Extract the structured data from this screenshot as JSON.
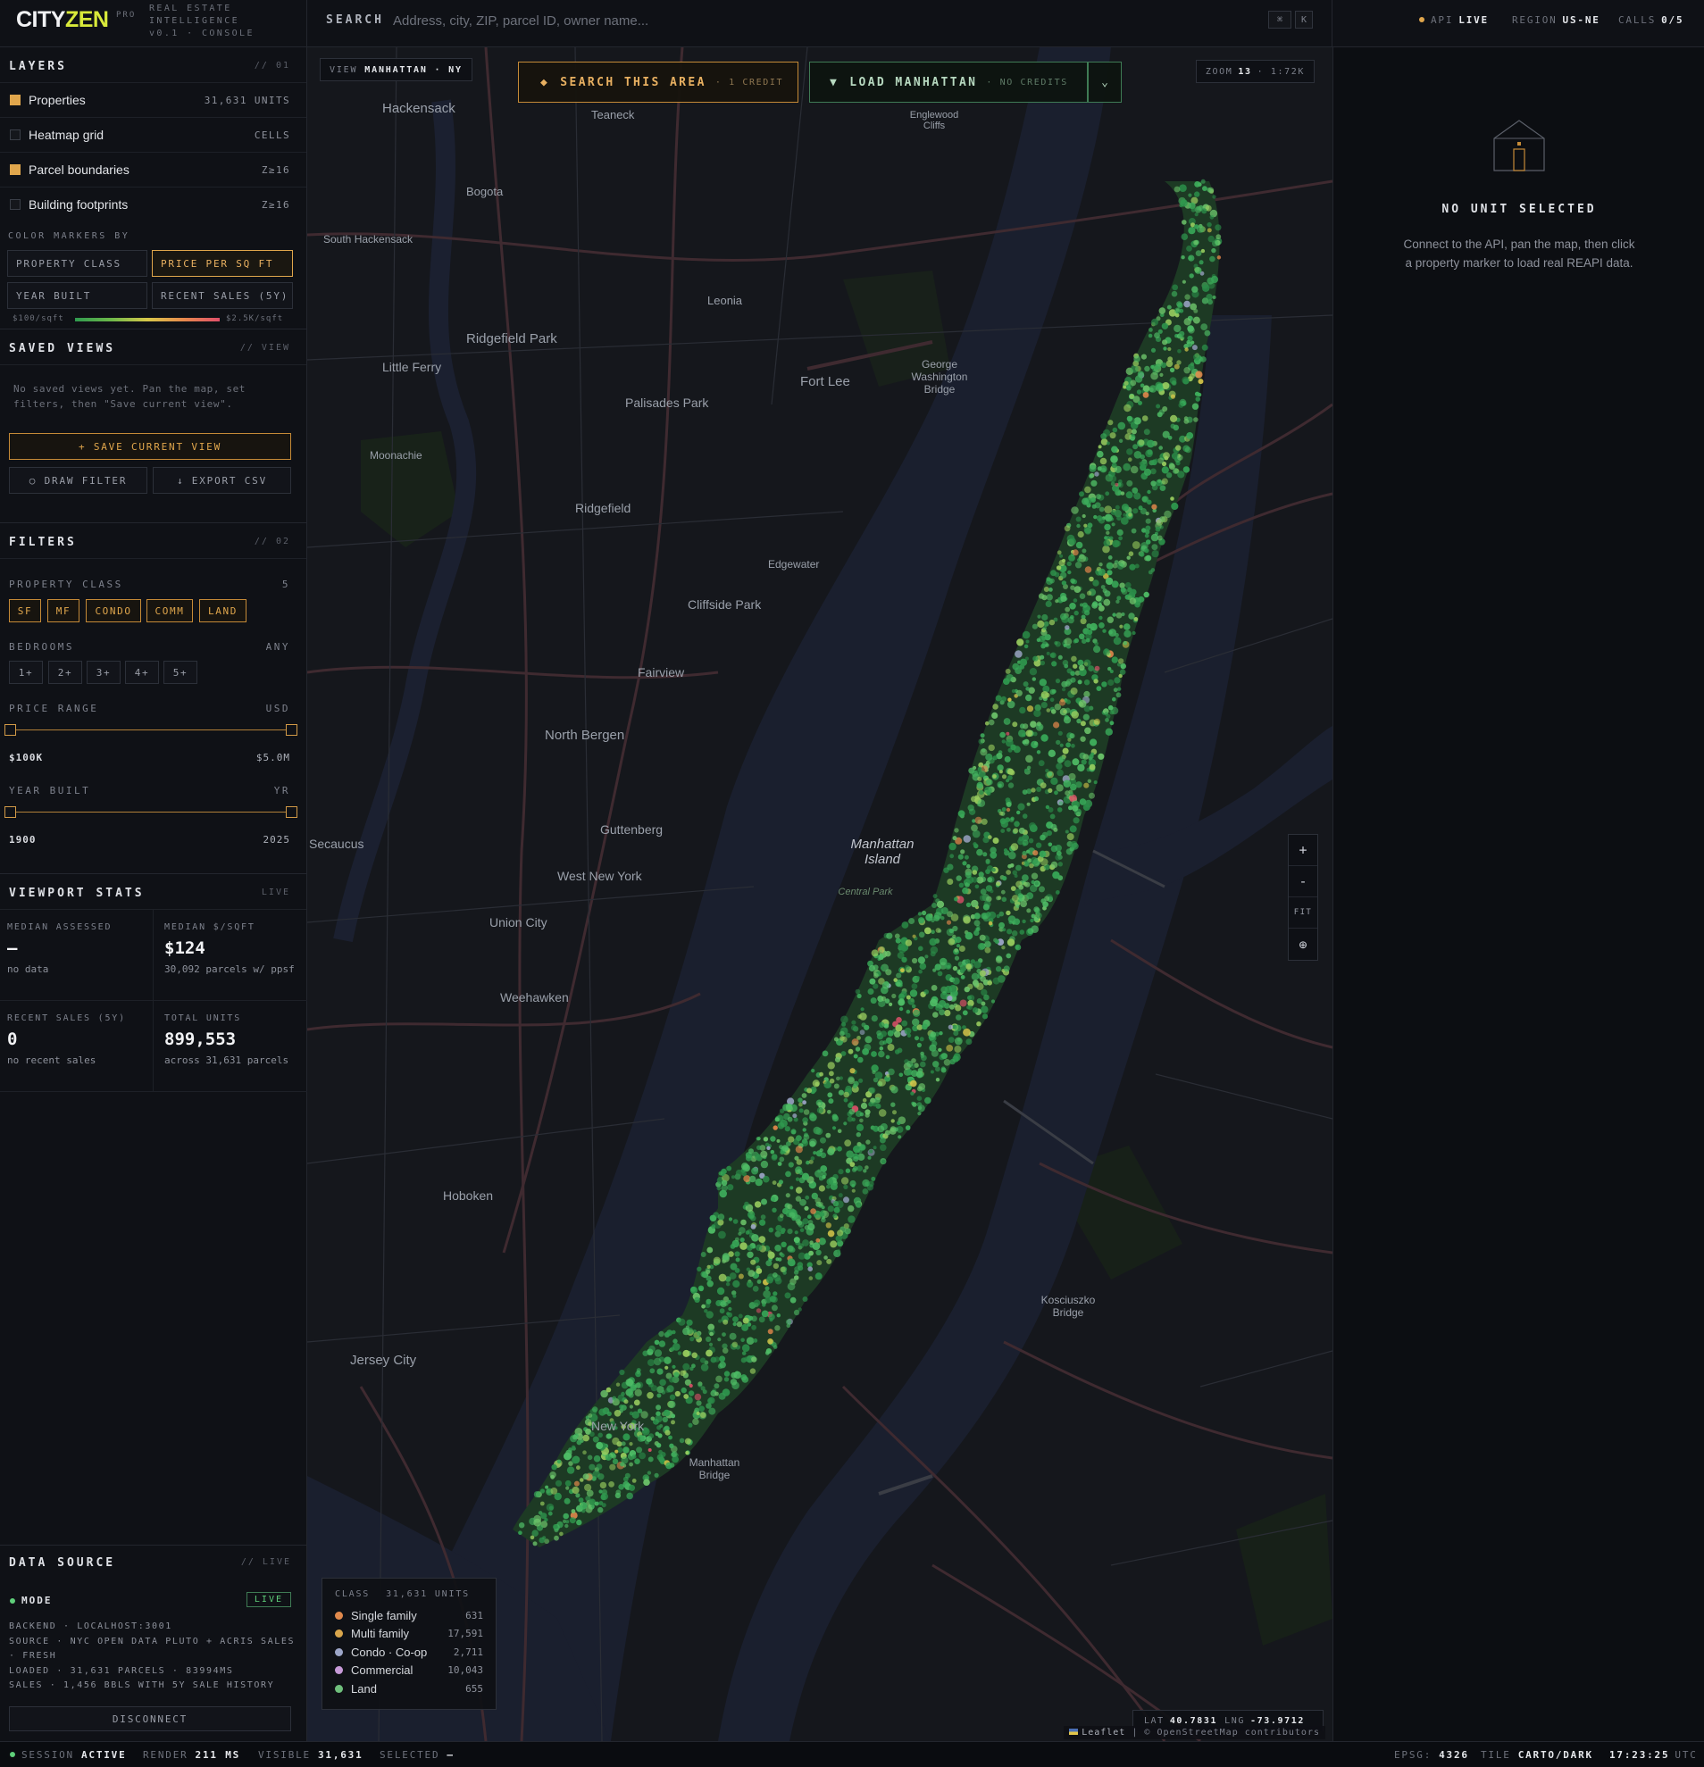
{
  "app": {
    "logo_a": "CITY",
    "logo_b": "ZEN",
    "tier": "PRO",
    "subtitle_1": "REAL ESTATE",
    "subtitle_2": "INTELLIGENCE",
    "subtitle_3": "v0.1 · CONSOLE"
  },
  "search": {
    "label": "SEARCH",
    "placeholder": "Address, city, ZIP, parcel ID, owner name...",
    "kbd_1": "⌘",
    "kbd_2": "K"
  },
  "status": {
    "api_label": "API",
    "api_value": "LIVE",
    "region_label": "REGION",
    "region_value": "US-NE",
    "calls_label": "CALLS",
    "calls_value": "0/5",
    "dot_color": "#e0a64c"
  },
  "layers": {
    "title": "LAYERS",
    "tag": "// 01",
    "items": [
      {
        "label": "Properties",
        "meta": "31,631 UNITS",
        "checked": true
      },
      {
        "label": "Heatmap grid",
        "meta": "CELLS",
        "checked": false
      },
      {
        "label": "Parcel boundaries",
        "meta": "Z≥16",
        "checked": true
      },
      {
        "label": "Building footprints",
        "meta": "Z≥16",
        "checked": false
      }
    ],
    "color_by_label": "COLOR MARKERS BY",
    "color_options": [
      "PROPERTY CLASS",
      "PRICE PER SQ FT",
      "YEAR BUILT",
      "RECENT SALES (5Y)"
    ],
    "color_selected": "PRICE PER SQ FT",
    "ramp_min": "$100/sqft",
    "ramp_max": "$2.5K/sqft",
    "ramp_colors": [
      "#2f9a4f",
      "#6db94a",
      "#d8c84a",
      "#e7894c",
      "#e0506a"
    ]
  },
  "saved_views": {
    "title": "SAVED VIEWS",
    "tag": "// VIEW",
    "empty": "No saved views yet. Pan the map, set filters, then \"Save current view\".",
    "save_button": "+ SAVE CURRENT VIEW",
    "draw_button": "○ DRAW FILTER",
    "export_button": "↓ EXPORT CSV"
  },
  "filters": {
    "title": "FILTERS",
    "tag": "// 02",
    "class_label": "PROPERTY CLASS",
    "class_count": "5",
    "class_chips": [
      "SF",
      "MF",
      "CONDO",
      "COMM",
      "LAND"
    ],
    "bedrooms_label": "BEDROOMS",
    "bedrooms_value": "ANY",
    "bedroom_chips": [
      "1+",
      "2+",
      "3+",
      "4+",
      "5+"
    ],
    "price_label": "PRICE RANGE",
    "price_unit": "USD",
    "price_min": "$100K",
    "price_max": "$5.0M",
    "year_label": "YEAR BUILT",
    "year_unit": "YR",
    "year_min": "1900",
    "year_max": "2025"
  },
  "viewport_stats": {
    "title": "VIEWPORT STATS",
    "tag": "LIVE",
    "cells": [
      {
        "label": "MEDIAN ASSESSED",
        "value": "—",
        "sub": "no data"
      },
      {
        "label": "MEDIAN $/SQFT",
        "value": "$124",
        "sub": "30,092 parcels w/ ppsf"
      },
      {
        "label": "RECENT SALES (5Y)",
        "value": "0",
        "sub": "no recent sales"
      },
      {
        "label": "TOTAL UNITS",
        "value": "899,553",
        "sub": "across 31,631 parcels"
      }
    ]
  },
  "data_source": {
    "title": "DATA SOURCE",
    "tag": "// LIVE",
    "mode_label": "MODE",
    "mode_badge": "LIVE",
    "line_1": "BACKEND · LOCALHOST:3001",
    "line_2": "SOURCE · NYC OPEN DATA PLUTO + ACRIS SALES",
    "line_3": "· FRESH",
    "line_4": "LOADED · 31,631 PARCELS · 83994MS",
    "line_5": "SALES · 1,456 BBLS WITH 5Y SALE HISTORY",
    "disconnect_button": "DISCONNECT"
  },
  "map": {
    "view_label": "VIEW",
    "view_value": "MANHATTAN · NY",
    "search_area_button": "SEARCH THIS AREA",
    "search_area_cost": "· 1 CREDIT",
    "load_button": "LOAD MANHATTAN",
    "load_cost": "· NO CREDITS",
    "zoom_label": "ZOOM",
    "zoom_value": "13",
    "scale": "· 1:72K",
    "zoom_in": "+",
    "zoom_out": "-",
    "fit": "FIT",
    "locate": "⊕",
    "lat_label": "LAT",
    "lat_value": "40.7831",
    "lng_label": "LNG",
    "lng_value": "-73.9712",
    "attribution_a": "Leaflet",
    "attribution_b": "| © OpenStreetMap contributors",
    "labels": [
      {
        "name": "Hackensack"
      },
      {
        "name": "Teaneck"
      },
      {
        "name": "Englewood Cliffs"
      },
      {
        "name": "Bogota"
      },
      {
        "name": "South Hackensack"
      },
      {
        "name": "Leonia"
      },
      {
        "name": "Ridgefield Park"
      },
      {
        "name": "Little Ferry"
      },
      {
        "name": "Fort Lee"
      },
      {
        "name": "Palisades Park"
      },
      {
        "name": "George Washington Bridge"
      },
      {
        "name": "Moonachie"
      },
      {
        "name": "Ridgefield"
      },
      {
        "name": "Edgewater"
      },
      {
        "name": "Cliffside Park"
      },
      {
        "name": "Fairview"
      },
      {
        "name": "North Bergen"
      },
      {
        "name": "Guttenberg"
      },
      {
        "name": "West New York"
      },
      {
        "name": "Manhattan Island"
      },
      {
        "name": "Union City"
      },
      {
        "name": "Weehawken"
      },
      {
        "name": "Hoboken"
      },
      {
        "name": "Jersey City"
      },
      {
        "name": "New York"
      },
      {
        "name": "Manhattan Bridge"
      },
      {
        "name": "Kosciuszko Bridge"
      },
      {
        "name": "Central Park"
      },
      {
        "name": "Secaucus"
      }
    ]
  },
  "legend": {
    "header": "CLASS",
    "total": "31,631 UNITS",
    "items": [
      {
        "label": "Single family",
        "count": "631",
        "color": "#e0894c"
      },
      {
        "label": "Multi family",
        "count": "17,591",
        "color": "#d9a64c"
      },
      {
        "label": "Condo · Co-op",
        "count": "2,711",
        "color": "#9da6c8"
      },
      {
        "label": "Commercial",
        "count": "10,043",
        "color": "#c79ad8"
      },
      {
        "label": "Land",
        "count": "655",
        "color": "#6fbf7c"
      }
    ]
  },
  "detail": {
    "empty_title": "NO UNIT SELECTED",
    "empty_text": "Connect to the API, pan the map, then click a property marker to load real REAPI data."
  },
  "bottombar": {
    "session_label": "SESSION",
    "session_value": "ACTIVE",
    "render_label": "RENDER",
    "render_value": "211 MS",
    "visible_label": "VISIBLE",
    "visible_value": "31,631",
    "selected_label": "SELECTED",
    "selected_value": "—",
    "epsg_label": "EPSG:",
    "epsg_value": "4326",
    "tile_label": "TILE",
    "tile_value": "CARTO/DARK",
    "time_value": "17:23:25",
    "time_zone": "UTC"
  }
}
